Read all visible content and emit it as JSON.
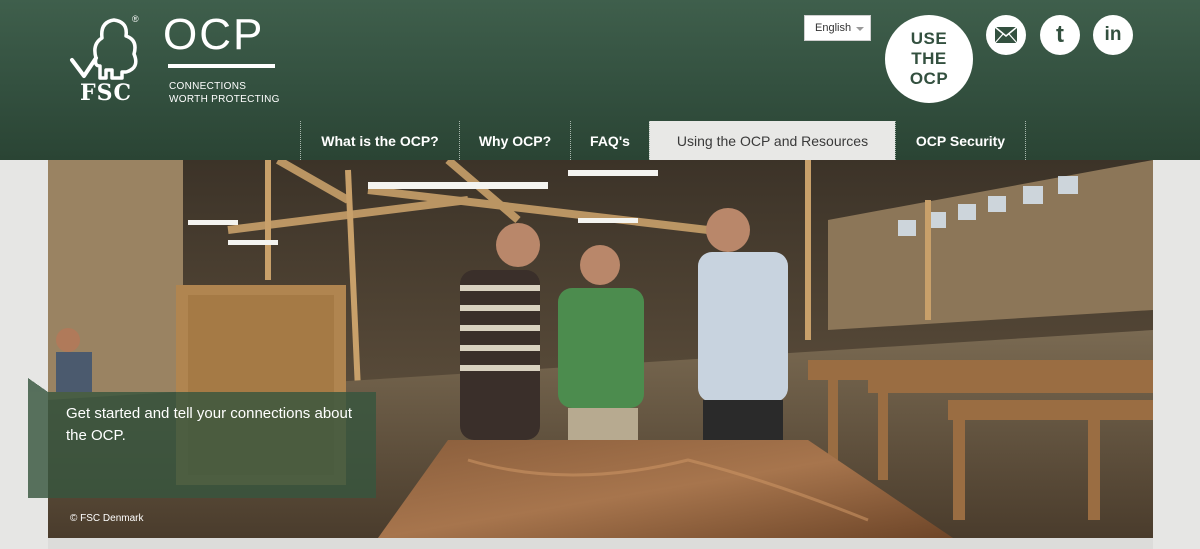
{
  "brand": {
    "fsc_text": "FSC",
    "registered": "®",
    "ocp_title": "OCP",
    "tagline_line1": "CONNECTIONS",
    "tagline_line2": "WORTH PROTECTING"
  },
  "language": {
    "selected": "English"
  },
  "cta": {
    "line1": "USE",
    "line2": "THE",
    "line3": "OCP"
  },
  "social": [
    {
      "name": "mail-icon",
      "glyph": "✉"
    },
    {
      "name": "twitter-icon",
      "glyph": "t"
    },
    {
      "name": "linkedin-icon",
      "glyph": "in"
    }
  ],
  "nav": {
    "items": [
      {
        "label": "What is the OCP?"
      },
      {
        "label": "Why OCP?"
      },
      {
        "label": "FAQ's"
      },
      {
        "label": "Using the OCP and Resources"
      },
      {
        "label": "OCP Security"
      }
    ],
    "active_index": 3
  },
  "hero": {
    "caption": "Get started and tell your connections about the OCP.",
    "credit": "© FSC Denmark"
  },
  "colors": {
    "header_green": "#33503f",
    "caption_green": "#37553e",
    "active_tab": "#e8e8e6"
  }
}
